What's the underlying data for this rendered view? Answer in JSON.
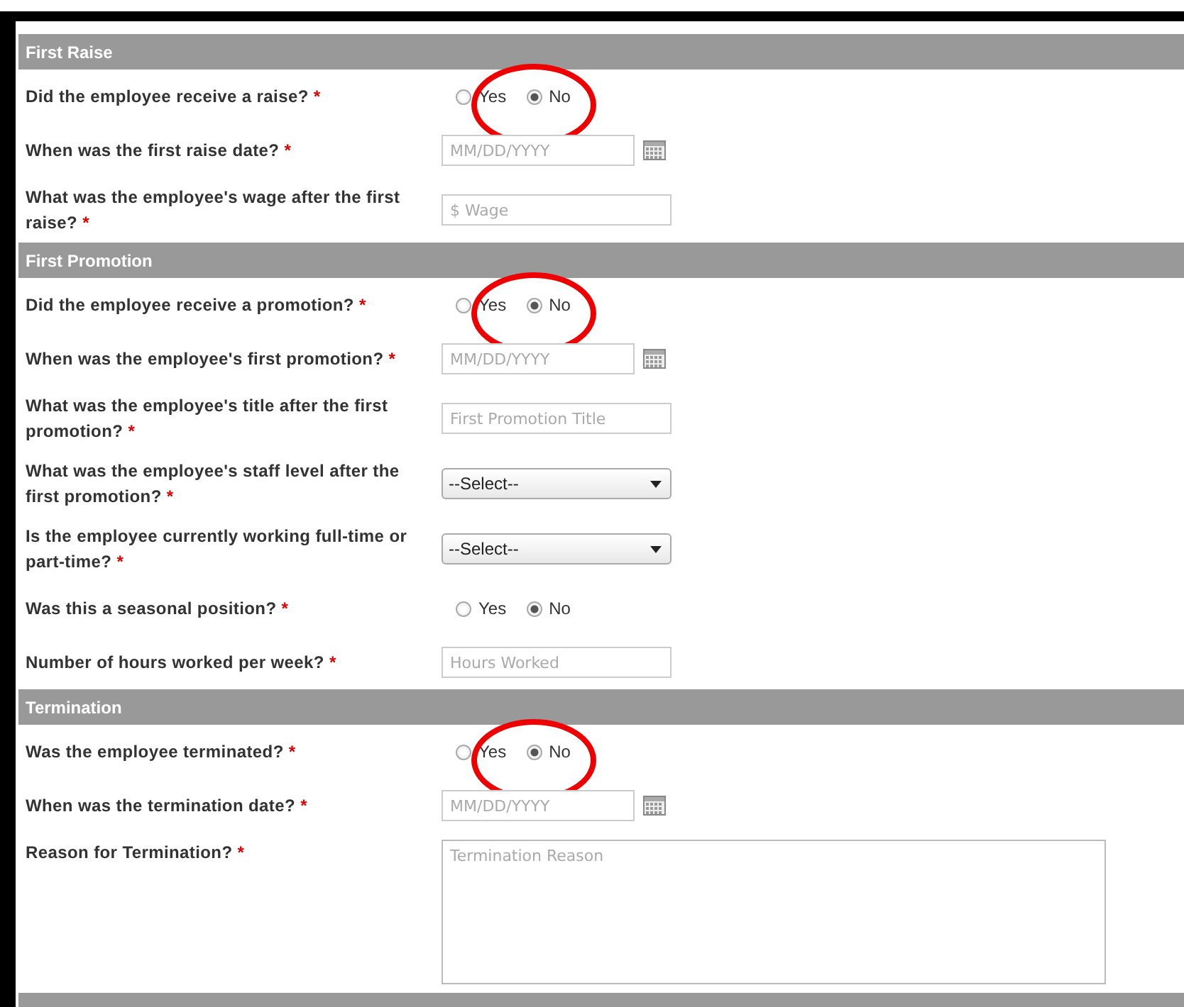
{
  "sections": [
    {
      "title": "First Raise",
      "fields": [
        {
          "kind": "radio",
          "label": "Did the employee receive a raise?",
          "required_mark": "*",
          "annotated": true,
          "options": [
            {
              "label": "Yes",
              "selected": false
            },
            {
              "label": "No",
              "selected": true
            }
          ]
        },
        {
          "kind": "date",
          "label": "When was the first raise date?",
          "required_mark": "*",
          "placeholder": "MM/DD/YYYY"
        },
        {
          "kind": "text",
          "label": "What was the employee's wage after the first raise?",
          "required_mark": "*",
          "placeholder": "$ Wage"
        }
      ]
    },
    {
      "title": "First Promotion",
      "fields": [
        {
          "kind": "radio",
          "label": "Did the employee receive a promotion?",
          "required_mark": "*",
          "annotated": true,
          "options": [
            {
              "label": "Yes",
              "selected": false
            },
            {
              "label": "No",
              "selected": true
            }
          ]
        },
        {
          "kind": "date",
          "label": "When was the employee's first promotion?",
          "required_mark": "*",
          "placeholder": "MM/DD/YYYY"
        },
        {
          "kind": "text",
          "label": "What was the employee's title after the first promotion?",
          "required_mark": "*",
          "placeholder": "First Promotion Title"
        },
        {
          "kind": "select",
          "label": "What was the employee's staff level after the first promotion?",
          "required_mark": "*",
          "value": "--Select--"
        },
        {
          "kind": "select",
          "label": "Is the employee currently working full-time or part-time?",
          "required_mark": "*",
          "value": "--Select--"
        },
        {
          "kind": "radio",
          "label": "Was this a seasonal position?",
          "required_mark": "*",
          "annotated": false,
          "options": [
            {
              "label": "Yes",
              "selected": false
            },
            {
              "label": "No",
              "selected": true
            }
          ]
        },
        {
          "kind": "text",
          "label": "Number of hours worked per week?",
          "required_mark": "*",
          "placeholder": "Hours Worked"
        }
      ]
    },
    {
      "title": "Termination",
      "fields": [
        {
          "kind": "radio",
          "label": "Was the employee terminated?",
          "required_mark": "*",
          "annotated": true,
          "options": [
            {
              "label": "Yes",
              "selected": false
            },
            {
              "label": "No",
              "selected": true
            }
          ]
        },
        {
          "kind": "date",
          "label": "When was the termination date?",
          "required_mark": "*",
          "placeholder": "MM/DD/YYYY"
        },
        {
          "kind": "textarea",
          "label": "Reason for Termination?",
          "required_mark": "*",
          "placeholder": "Termination Reason"
        }
      ]
    },
    {
      "kind": "bar"
    }
  ]
}
